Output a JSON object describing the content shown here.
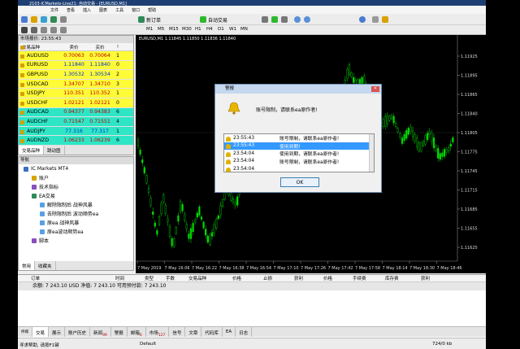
{
  "window": {
    "title": "2103-ICMarkets-Live21: 自动交易 - [EURUSD,M1]"
  },
  "menu": [
    "文件",
    "查看",
    "插入",
    "图表",
    "工具",
    "窗口",
    "帮助"
  ],
  "toolbar": {
    "new_order": "新订单",
    "auto_trading": "自动交易"
  },
  "timeframes": [
    "M1",
    "M5",
    "M15",
    "M30",
    "H1",
    "H4",
    "D1",
    "W1",
    "MN"
  ],
  "market_watch": {
    "header": "市场报价: 23:55:43",
    "columns": [
      "交易品种",
      "卖价",
      "买价",
      "!"
    ],
    "rows": [
      {
        "symbol": "AUDUSD",
        "bid": "0.70063",
        "ask": "0.70064",
        "spread": "1",
        "style": "y"
      },
      {
        "symbol": "EURUSD",
        "bid": "1.11840",
        "ask": "1.11840",
        "spread": "0",
        "style": "yb"
      },
      {
        "symbol": "GBPUSD",
        "bid": "1.30532",
        "ask": "1.30534",
        "spread": "2",
        "style": "yb"
      },
      {
        "symbol": "USDCAD",
        "bid": "1.34707",
        "ask": "1.34710",
        "spread": "3",
        "style": "y"
      },
      {
        "symbol": "USDJPY",
        "bid": "110.351",
        "ask": "110.352",
        "spread": "1",
        "style": "y"
      },
      {
        "symbol": "USDCHF",
        "bid": "1.02121",
        "ask": "1.02121",
        "spread": "0",
        "style": "y"
      },
      {
        "symbol": "AUDCAD",
        "bid": "0.94377",
        "ask": "0.94383",
        "spread": "6",
        "style": "g"
      },
      {
        "symbol": "AUDCHF",
        "bid": "0.71547",
        "ask": "0.71551",
        "spana": "",
        "spread": "4",
        "style": "g"
      },
      {
        "symbol": "AUDJPY",
        "bid": "77.316",
        "ask": "77.317",
        "spread": "1",
        "style": "gb"
      },
      {
        "symbol": "AUDNZD",
        "bid": "1.06233",
        "ask": "1.06239",
        "spread": "6",
        "style": "g"
      }
    ],
    "tabs": [
      "交易品种",
      "跳动图"
    ]
  },
  "navigator": {
    "header": "导航",
    "items": [
      {
        "label": "IC Markets MT4",
        "indent": 0
      },
      {
        "label": "账户",
        "indent": 1
      },
      {
        "label": "技术指标",
        "indent": 1
      },
      {
        "label": "EA交易",
        "indent": 1
      },
      {
        "label": "解除限制后 战神风暴",
        "indent": 2
      },
      {
        "label": "去除限制后 波动顺势ea",
        "indent": 2
      },
      {
        "label": "原ea 战神风暴",
        "indent": 2
      },
      {
        "label": "原ea波动顺势ea",
        "indent": 2
      },
      {
        "label": "脚本",
        "indent": 1
      }
    ],
    "tabs": [
      "常用",
      "收藏夹"
    ]
  },
  "chart": {
    "title": "EURUSD,M1  1.11845 1.11850 1.11836 1.11840",
    "prices": [
      "1.11925",
      "1.11895",
      "1.11865",
      "1.11840",
      "1.11805",
      "1.11775",
      "1.11745",
      "1.11715",
      "1.11685",
      "1.11655",
      "1.11625"
    ],
    "times": [
      "7 May 2019",
      "7 May 16:06",
      "7 May 16:22",
      "7 May 16:38",
      "7 May 16:54",
      "7 May 17:10",
      "7 May 17:26",
      "7 May 17:42",
      "7 May 17:58",
      "7 May 18:14",
      "7 May 18:30",
      "7 May 18:46"
    ]
  },
  "dialog": {
    "title": "警报",
    "message": "账号限制，请联系ea原作者!",
    "ok": "OK",
    "log": [
      {
        "time": "23:55:43",
        "text": "账号限制，请联系ea原作者!",
        "selected": false
      },
      {
        "time": "23:55:43",
        "text": "使用到期!",
        "selected": true
      },
      {
        "time": "23:54:04",
        "text": "使用到期，请联系ea原作者!",
        "selected": false
      },
      {
        "time": "23:54:04",
        "text": "账号限制，请联系ea原作者!",
        "selected": false
      },
      {
        "time": "23:54:04",
        "text": "",
        "selected": false
      }
    ]
  },
  "terminal": {
    "columns": [
      "订单",
      "时间",
      "类型",
      "手数",
      "交易品种",
      "价格",
      "止损",
      "获利",
      "价格",
      "手续费",
      "库存费",
      "获利"
    ],
    "balance": "余额: 7 243.10 USD  净值: 7 243.10  可用预付款: 7 243.10",
    "tabs": [
      {
        "label": "交易",
        "badge": ""
      },
      {
        "label": "展示",
        "badge": ""
      },
      {
        "label": "账户历史",
        "badge": ""
      },
      {
        "label": "新闻",
        "badge": "99"
      },
      {
        "label": "警报",
        "badge": ""
      },
      {
        "label": "邮箱",
        "badge": "6"
      },
      {
        "label": "市场",
        "badge": "127"
      },
      {
        "label": "信号",
        "badge": ""
      },
      {
        "label": "文章",
        "badge": ""
      },
      {
        "label": "代码库",
        "badge": ""
      },
      {
        "label": "EA",
        "badge": ""
      },
      {
        "label": "日志",
        "badge": ""
      }
    ],
    "side_label": "终端"
  },
  "status": {
    "help": "寻求帮助, 请按F1键",
    "profile": "Default",
    "traffic": "724/0 kb"
  },
  "colors": {
    "bull": "#00dd00",
    "bear": "#00dd00",
    "grid": "#333333"
  }
}
